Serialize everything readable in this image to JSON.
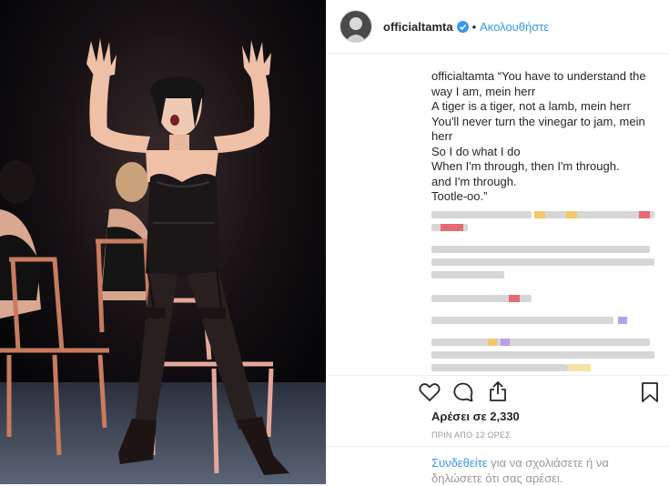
{
  "post": {
    "username": "officialtamta",
    "follow_label": "Ακολουθήστε",
    "dot": "•",
    "caption_user": "officialtamta",
    "caption_lines": [
      "“You have to understand the",
      "way I am, mein herr",
      "A tiger is a tiger, not a lamb, mein herr",
      "You'll never turn the vinegar to jam, mein",
      "herr",
      "So I do what I do",
      "When I'm through, then I'm through.",
      "and I'm through.",
      "Tootle-oo.”"
    ],
    "likes": "Αρέσει σε 2,330",
    "time_ago": "ΠΡΙΝ ΑΠΟ 12 ΩΡΕΣ",
    "login_link": "Συνδεθείτε",
    "login_text_1": " για να σχολιάσετε ή να",
    "login_text_2": "δηλώσετε ότι σας αρέσει."
  },
  "icons": {
    "like": "heart-icon",
    "comment": "comment-icon",
    "share": "share-icon",
    "save": "bookmark-icon",
    "verified": "verified-badge-icon"
  },
  "colors": {
    "accent": "#3897f0",
    "muted": "#999999",
    "text": "#262626"
  }
}
